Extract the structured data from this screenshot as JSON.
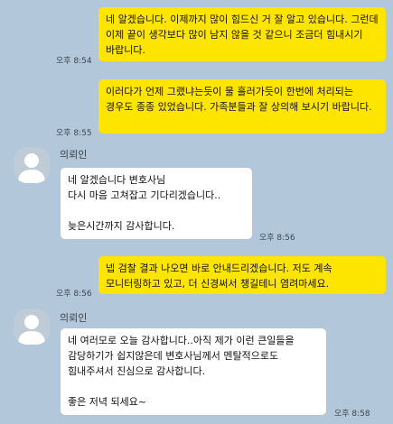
{
  "messages": [
    {
      "text": "네 알겠습니다. 이제까지 많이 힘드신 거 잘 알고 있습니다. 그런데 이제 끝이 생각보다 많이 남지 않을 것 같으니 조금더 힘내시기 바랍니다.",
      "time": "오후 8:54"
    },
    {
      "text": "이러다가 언제 그랬냐는듯이 물 흘러가듯이 한번에 처리되는 경우도 종종 있었습니다. 가족분들과 잘 상의해 보시기 바랍니다.",
      "time": "오후 8:55"
    },
    {
      "sender": "의뢰인",
      "text": "네 알겠습니다 변호사님\n다시 마음 고쳐잡고 기다리겠습니다..\n\n늦은시간까지 감사합니다.",
      "time": "오후 8:56"
    },
    {
      "text": "넵 검찰 결과 나오면 바로 안내드리겠습니다. 저도 계속 모니터링하고 있고, 더 신경써서 챙길테니 염려마세요.",
      "time": "오후 8:56"
    },
    {
      "sender": "의뢰인",
      "text": "네 여러모로 오늘 감사합니다..아직 제가 이런 큰일들을 감당하기가 쉽지않은데 변호사님께서 멘탈적으로도 힘내주셔서 진심으로 감사합니다.\n\n좋은 저녁 되세요~",
      "time": "오후 8:58"
    }
  ]
}
